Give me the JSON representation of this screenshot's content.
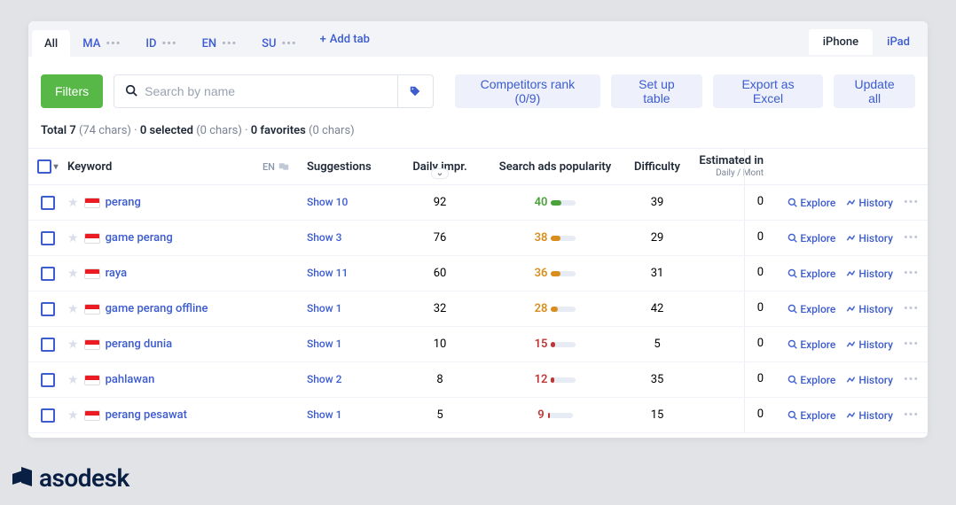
{
  "tabs": {
    "list": [
      {
        "label": "All",
        "active": true,
        "dots": false
      },
      {
        "label": "MA",
        "active": false,
        "dots": true
      },
      {
        "label": "ID",
        "active": false,
        "dots": true
      },
      {
        "label": "EN",
        "active": false,
        "dots": true
      },
      {
        "label": "SU",
        "active": false,
        "dots": true
      }
    ],
    "add_label": "Add tab"
  },
  "device_tabs": [
    {
      "label": "iPhone",
      "active": true
    },
    {
      "label": "iPad",
      "active": false
    }
  ],
  "toolbar": {
    "filters": "Filters",
    "search_placeholder": "Search by name",
    "competitors": "Competitors rank (0/9)",
    "setup": "Set up table",
    "export": "Export as Excel",
    "update": "Update all"
  },
  "summary": {
    "total_label": "Total 7",
    "total_chars": "(74 chars)",
    "sep": " · ",
    "selected_label": "0 selected",
    "selected_chars": "(0 chars)",
    "fav_label": "0 favorites",
    "fav_chars": "(0 chars)"
  },
  "columns": {
    "keyword": "Keyword",
    "lang_code": "EN",
    "suggestions": "Suggestions",
    "daily_impr": "Daily impr.",
    "sap": "Search ads popularity",
    "difficulty": "Difficulty",
    "est": "Estimated in",
    "est_sub": "Daily / Mont"
  },
  "actions": {
    "explore": "Explore",
    "history": "History"
  },
  "rows": [
    {
      "keyword": "perang",
      "sugg": "Show 10",
      "impr": "92",
      "sap": "40",
      "sap_class": "green",
      "sap_pct": 40,
      "diff": "39",
      "est": "0"
    },
    {
      "keyword": "game perang",
      "sugg": "Show 3",
      "impr": "76",
      "sap": "38",
      "sap_class": "orange",
      "sap_pct": 38,
      "diff": "29",
      "est": "0"
    },
    {
      "keyword": "raya",
      "sugg": "Show 11",
      "impr": "60",
      "sap": "36",
      "sap_class": "orange",
      "sap_pct": 36,
      "diff": "31",
      "est": "0"
    },
    {
      "keyword": "game perang offline",
      "sugg": "Show 1",
      "impr": "32",
      "sap": "28",
      "sap_class": "orange",
      "sap_pct": 28,
      "diff": "42",
      "est": "0"
    },
    {
      "keyword": "perang dunia",
      "sugg": "Show 1",
      "impr": "10",
      "sap": "15",
      "sap_class": "red",
      "sap_pct": 15,
      "diff": "5",
      "est": "0"
    },
    {
      "keyword": "pahlawan",
      "sugg": "Show 2",
      "impr": "8",
      "sap": "12",
      "sap_class": "red",
      "sap_pct": 12,
      "diff": "35",
      "est": "0"
    },
    {
      "keyword": "perang pesawat",
      "sugg": "Show 1",
      "impr": "5",
      "sap": "9",
      "sap_class": "red",
      "sap_pct": 9,
      "diff": "15",
      "est": "0"
    }
  ],
  "brand": "asodesk"
}
